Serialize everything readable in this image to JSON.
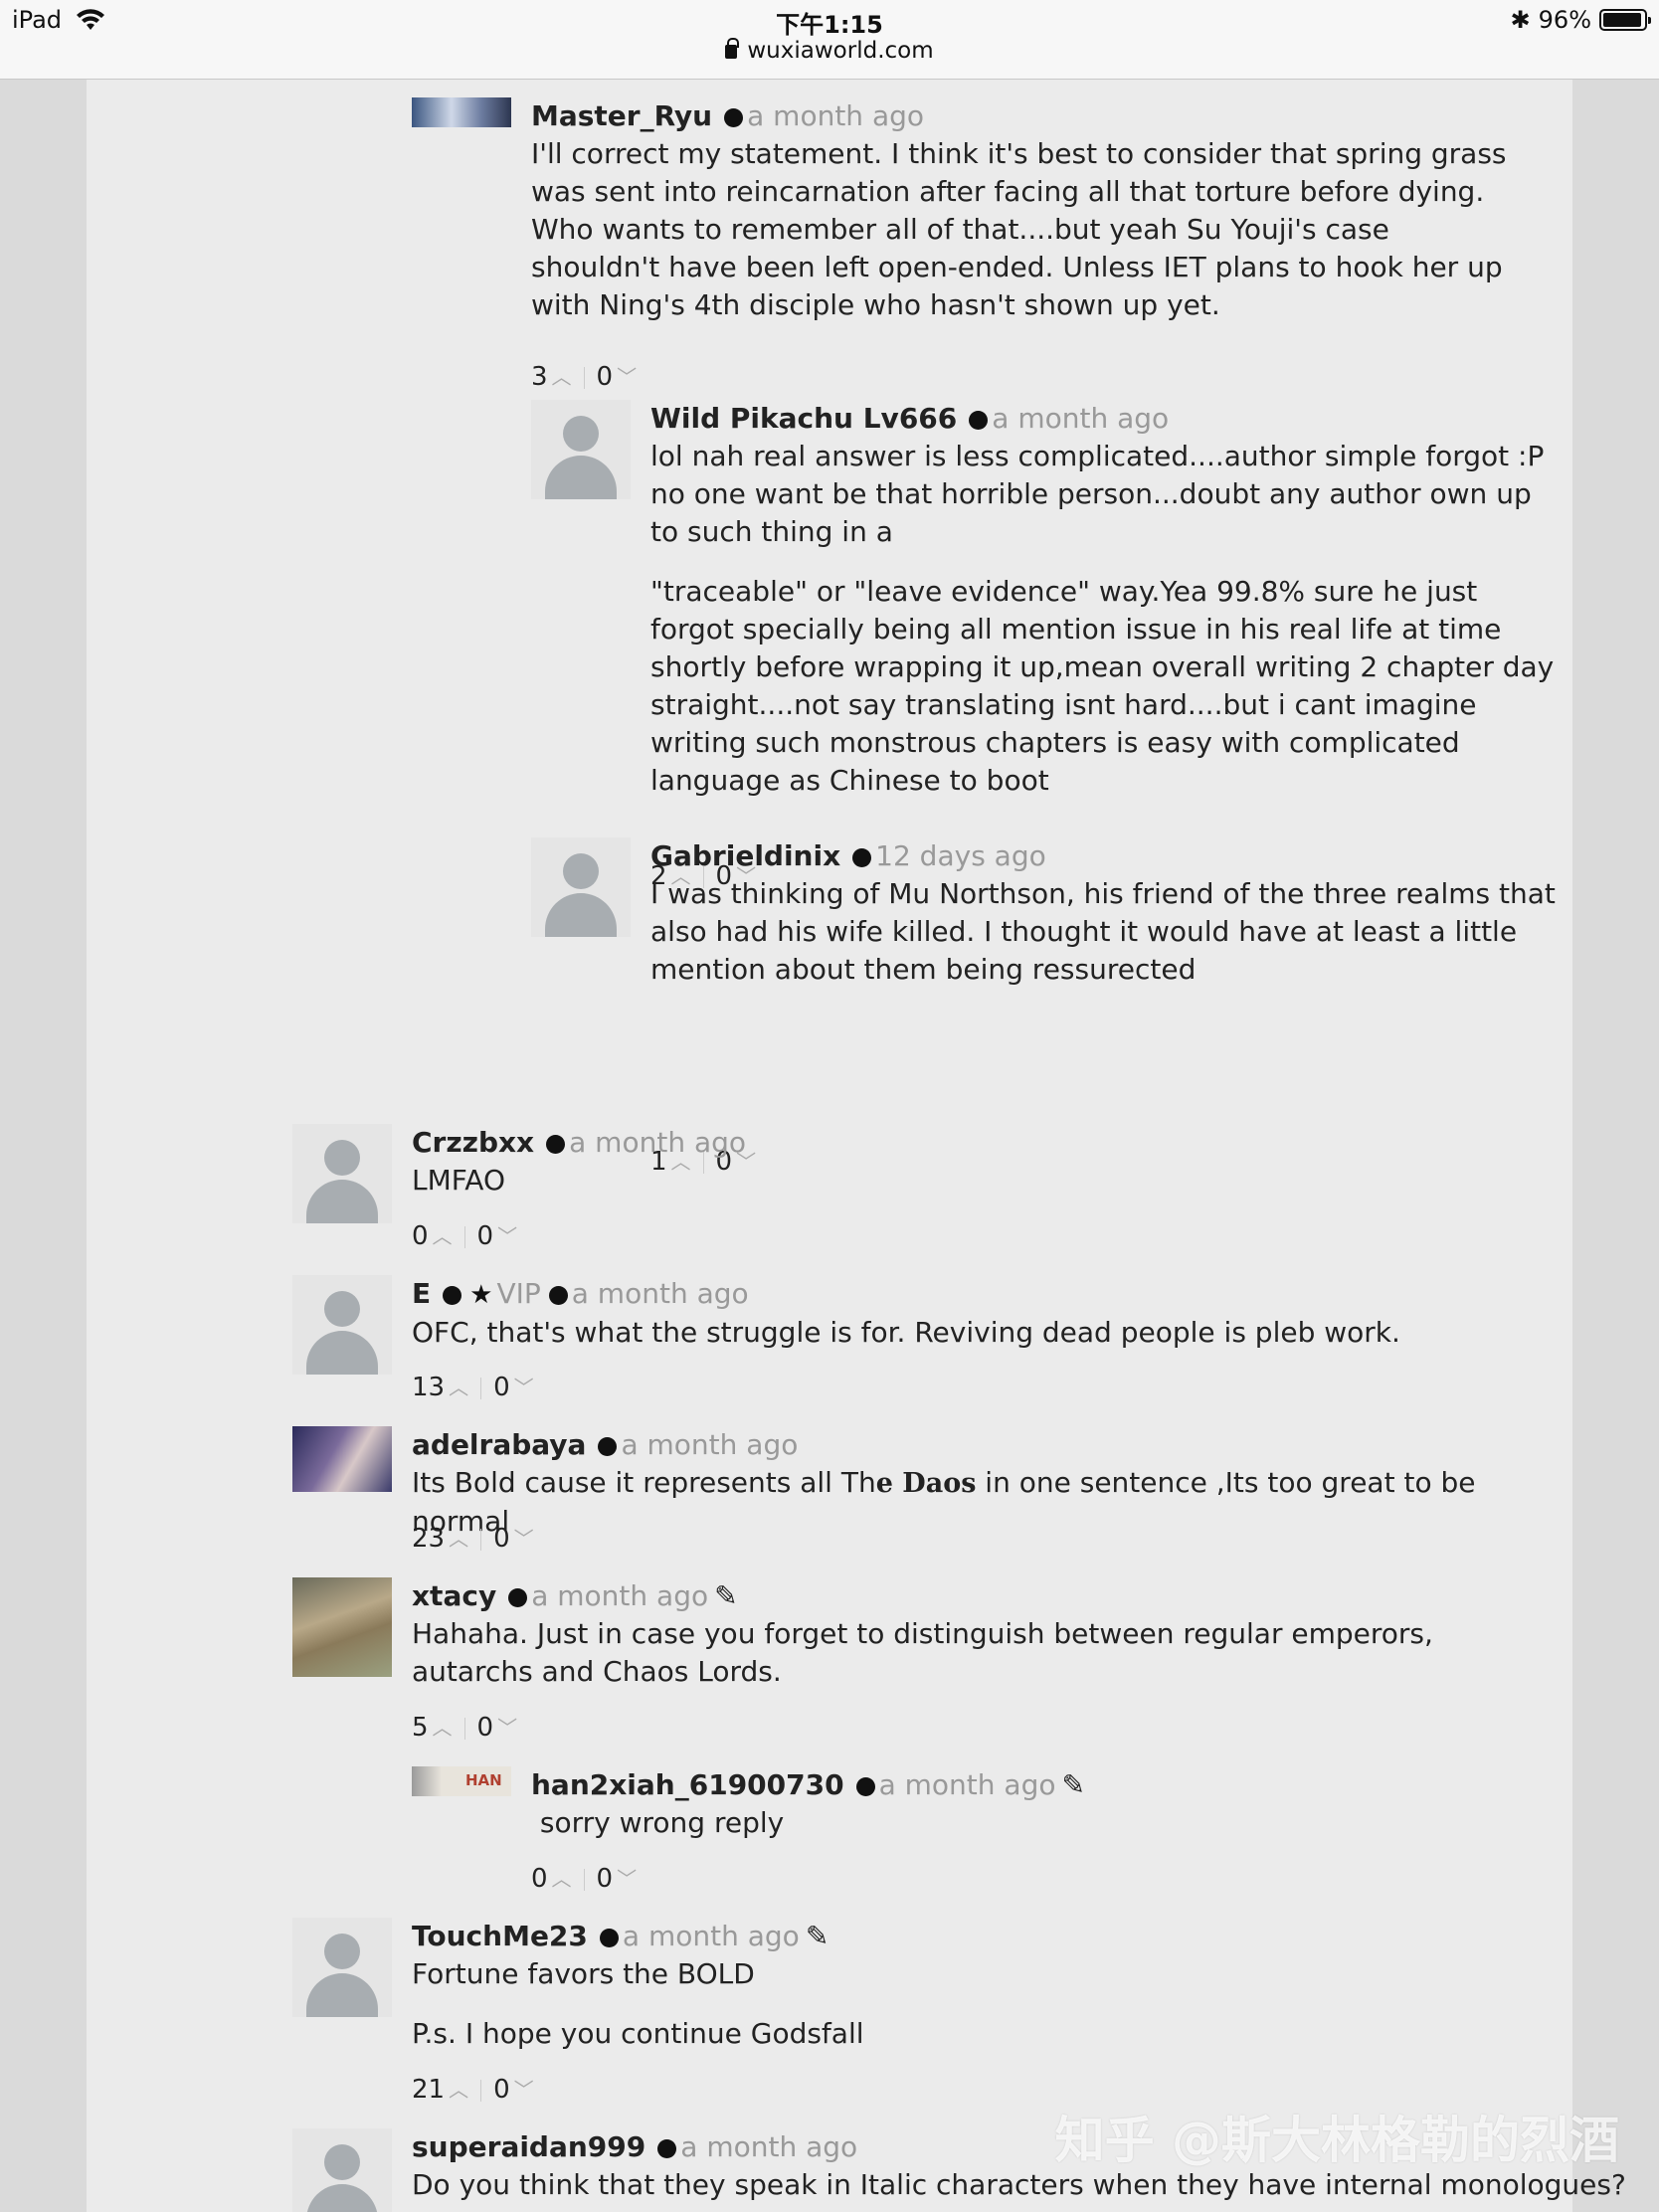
{
  "status_bar": {
    "device": "iPad",
    "time": "下午1:15",
    "url": "wuxiaworld.com",
    "battery": "96%",
    "battery_level": 0.96
  },
  "comments": [
    {
      "name": "Master_Ryu",
      "time": "a month ago",
      "text": [
        "I'll correct my statement. I think it's best to consider that spring grass was sent into reincarnation after facing all that    torture before dying. Who wants to remember all of that....but yeah Su Youji's case shouldn't have been left open-ended. Unless IET plans to hook her up with Ning's 4th disciple who hasn't shown up yet."
      ],
      "up": "3",
      "down": "0"
    },
    {
      "name": "Wild Pikachu Lv666",
      "time": "a month ago",
      "text": [
        "lol nah real answer is less complicated....author simple forgot :P no one want be that horrible person...doubt any author own up to such thing in a",
        "\"traceable\" or  \"leave evidence\" way.Yea 99.8% sure he just forgot specially being all mention issue in his real life at time shortly before wrapping it up,mean overall writing 2 chapter day  straight....not say translating isnt hard....but i cant imagine writing such monstrous chapters is easy with complicated language as Chinese to boot"
      ],
      "up": "2",
      "down": "0"
    },
    {
      "name": "Gabrieldinix",
      "time": "12 days ago",
      "text": [
        "I was thinking of Mu Northson, his friend of the three realms that also had his wife killed. I thought it would have at least a little mention about them being ressurected"
      ],
      "up": "1",
      "down": "0"
    },
    {
      "name": "Crzzbxx",
      "time": "a month ago",
      "text": [
        "LMFAO"
      ],
      "up": "0",
      "down": "0"
    },
    {
      "name": "E",
      "badge": "VIP",
      "time": "a month ago",
      "text": [
        "OFC, that's what the struggle is for. Reviving dead people is pleb work."
      ],
      "up": "13",
      "down": "0"
    },
    {
      "name": "adelrabaya",
      "time": "a month ago",
      "text_before": "Its Bold cause it represents all Th",
      "text_bold": "e Daos",
      "text_after": " in one sentence ,Its too great to be normal",
      "up": "23",
      "down": "0"
    },
    {
      "name": "xtacy",
      "time": "a month ago",
      "text": [
        "Hahaha. Just in case you forget to distinguish between regular emperors, autarchs and Chaos Lords."
      ],
      "up": "5",
      "down": "0"
    },
    {
      "name": "han2xiah_61900730",
      "avatar_text": "HAN",
      "time": "a month ago",
      "text": [
        " sorry wrong reply"
      ],
      "up": "0",
      "down": "0"
    },
    {
      "name": "TouchMe23",
      "time": "a month ago",
      "text": [
        "Fortune favors the BOLD",
        "P.s. I hope you continue Godsfall"
      ],
      "up": "21",
      "down": "0"
    },
    {
      "name": "superaidan999",
      "time": "a month ago",
      "text": [
        "Do you think that they speak in Italic characters when they have internal monologues?"
      ]
    }
  ],
  "watermark": "知乎 @斯大林格勒的烈酒"
}
